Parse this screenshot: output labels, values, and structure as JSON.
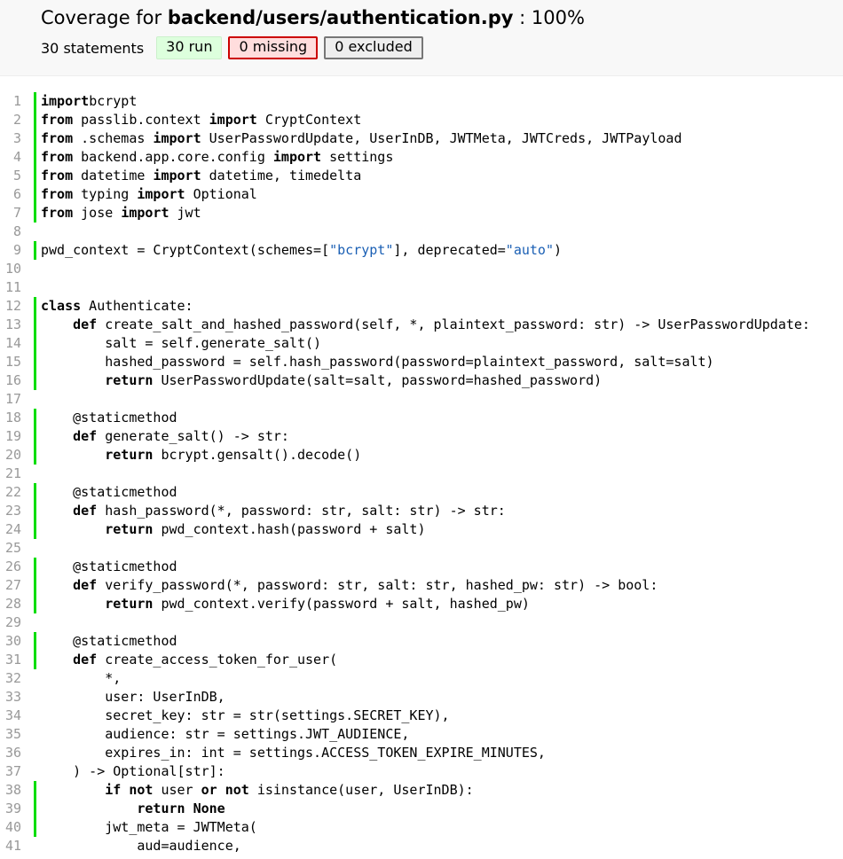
{
  "header": {
    "title_prefix": "Coverage for ",
    "file": "backend/users/authentication.py",
    "title_suffix": " : 100%",
    "statements": "30 statements",
    "run": "30 run",
    "missing": "0 missing",
    "excluded": "0 excluded"
  },
  "source": [
    {
      "n": "1",
      "run": true,
      "t": [
        [
          "k",
          "import"
        ],
        [
          "",
          "bcrypt"
        ]
      ]
    },
    {
      "n": "2",
      "run": true,
      "t": [
        [
          "k",
          "from"
        ],
        [
          "",
          " passlib.context "
        ],
        [
          "k",
          "import"
        ],
        [
          "",
          " CryptContext"
        ]
      ]
    },
    {
      "n": "3",
      "run": true,
      "t": [
        [
          "k",
          "from"
        ],
        [
          "",
          " .schemas "
        ],
        [
          "k",
          "import"
        ],
        [
          "",
          " UserPasswordUpdate, UserInDB, JWTMeta, JWTCreds, JWTPayload"
        ]
      ]
    },
    {
      "n": "4",
      "run": true,
      "t": [
        [
          "k",
          "from"
        ],
        [
          "",
          " backend.app.core.config "
        ],
        [
          "k",
          "import"
        ],
        [
          "",
          " settings"
        ]
      ]
    },
    {
      "n": "5",
      "run": true,
      "t": [
        [
          "k",
          "from"
        ],
        [
          "",
          " datetime "
        ],
        [
          "k",
          "import"
        ],
        [
          "",
          " datetime, timedelta"
        ]
      ]
    },
    {
      "n": "6",
      "run": true,
      "t": [
        [
          "k",
          "from"
        ],
        [
          "",
          " typing "
        ],
        [
          "k",
          "import"
        ],
        [
          "",
          " Optional"
        ]
      ]
    },
    {
      "n": "7",
      "run": true,
      "t": [
        [
          "k",
          "from"
        ],
        [
          "",
          " jose "
        ],
        [
          "k",
          "import"
        ],
        [
          "",
          " jwt"
        ]
      ]
    },
    {
      "n": "8",
      "run": false,
      "t": []
    },
    {
      "n": "9",
      "run": true,
      "t": [
        [
          "",
          "pwd_context = CryptContext(schemes=["
        ],
        [
          "s",
          "\"bcrypt\""
        ],
        [
          "",
          "], deprecated="
        ],
        [
          "s",
          "\"auto\""
        ],
        [
          "",
          ")"
        ]
      ]
    },
    {
      "n": "10",
      "run": false,
      "t": []
    },
    {
      "n": "11",
      "run": false,
      "t": []
    },
    {
      "n": "12",
      "run": true,
      "t": [
        [
          "k",
          "class"
        ],
        [
          "",
          " Authenticate:"
        ]
      ]
    },
    {
      "n": "13",
      "run": true,
      "t": [
        [
          "",
          "    "
        ],
        [
          "k",
          "def"
        ],
        [
          "",
          " create_salt_and_hashed_password(self, *, plaintext_password: str) -> UserPasswordUpdate:"
        ]
      ]
    },
    {
      "n": "14",
      "run": true,
      "t": [
        [
          "",
          "        salt = self.generate_salt()"
        ]
      ]
    },
    {
      "n": "15",
      "run": true,
      "t": [
        [
          "",
          "        hashed_password = self.hash_password(password=plaintext_password, salt=salt)"
        ]
      ]
    },
    {
      "n": "16",
      "run": true,
      "t": [
        [
          "",
          "        "
        ],
        [
          "k",
          "return"
        ],
        [
          "",
          " UserPasswordUpdate(salt=salt, password=hashed_password)"
        ]
      ]
    },
    {
      "n": "17",
      "run": false,
      "t": []
    },
    {
      "n": "18",
      "run": true,
      "t": [
        [
          "",
          "    @staticmethod"
        ]
      ]
    },
    {
      "n": "19",
      "run": true,
      "t": [
        [
          "",
          "    "
        ],
        [
          "k",
          "def"
        ],
        [
          "",
          " generate_salt() -> str:"
        ]
      ]
    },
    {
      "n": "20",
      "run": true,
      "t": [
        [
          "",
          "        "
        ],
        [
          "k",
          "return"
        ],
        [
          "",
          " bcrypt.gensalt().decode()"
        ]
      ]
    },
    {
      "n": "21",
      "run": false,
      "t": []
    },
    {
      "n": "22",
      "run": true,
      "t": [
        [
          "",
          "    @staticmethod"
        ]
      ]
    },
    {
      "n": "23",
      "run": true,
      "t": [
        [
          "",
          "    "
        ],
        [
          "k",
          "def"
        ],
        [
          "",
          " hash_password(*, password: str, salt: str) -> str:"
        ]
      ]
    },
    {
      "n": "24",
      "run": true,
      "t": [
        [
          "",
          "        "
        ],
        [
          "k",
          "return"
        ],
        [
          "",
          " pwd_context.hash(password + salt)"
        ]
      ]
    },
    {
      "n": "25",
      "run": false,
      "t": []
    },
    {
      "n": "26",
      "run": true,
      "t": [
        [
          "",
          "    @staticmethod"
        ]
      ]
    },
    {
      "n": "27",
      "run": true,
      "t": [
        [
          "",
          "    "
        ],
        [
          "k",
          "def"
        ],
        [
          "",
          " verify_password(*, password: str, salt: str, hashed_pw: str) -> bool:"
        ]
      ]
    },
    {
      "n": "28",
      "run": true,
      "t": [
        [
          "",
          "        "
        ],
        [
          "k",
          "return"
        ],
        [
          "",
          " pwd_context.verify(password + salt, hashed_pw)"
        ]
      ]
    },
    {
      "n": "29",
      "run": false,
      "t": []
    },
    {
      "n": "30",
      "run": true,
      "t": [
        [
          "",
          "    @staticmethod"
        ]
      ]
    },
    {
      "n": "31",
      "run": true,
      "t": [
        [
          "",
          "    "
        ],
        [
          "k",
          "def"
        ],
        [
          "",
          " create_access_token_for_user("
        ]
      ]
    },
    {
      "n": "32",
      "run": false,
      "t": [
        [
          "",
          "        *,"
        ]
      ]
    },
    {
      "n": "33",
      "run": false,
      "t": [
        [
          "",
          "        user: UserInDB,"
        ]
      ]
    },
    {
      "n": "34",
      "run": false,
      "t": [
        [
          "",
          "        secret_key: str = str(settings.SECRET_KEY),"
        ]
      ]
    },
    {
      "n": "35",
      "run": false,
      "t": [
        [
          "",
          "        audience: str = settings.JWT_AUDIENCE,"
        ]
      ]
    },
    {
      "n": "36",
      "run": false,
      "t": [
        [
          "",
          "        expires_in: int = settings.ACCESS_TOKEN_EXPIRE_MINUTES,"
        ]
      ]
    },
    {
      "n": "37",
      "run": false,
      "t": [
        [
          "",
          "    ) -> Optional[str]:"
        ]
      ]
    },
    {
      "n": "38",
      "run": true,
      "t": [
        [
          "",
          "        "
        ],
        [
          "k",
          "if not"
        ],
        [
          "",
          " user "
        ],
        [
          "k",
          "or not"
        ],
        [
          "",
          " isinstance(user, UserInDB):"
        ]
      ]
    },
    {
      "n": "39",
      "run": true,
      "t": [
        [
          "",
          "            "
        ],
        [
          "k",
          "return None"
        ]
      ]
    },
    {
      "n": "40",
      "run": true,
      "t": [
        [
          "",
          "        jwt_meta = JWTMeta("
        ]
      ]
    },
    {
      "n": "41",
      "run": false,
      "t": [
        [
          "",
          "            aud=audience,"
        ]
      ]
    }
  ]
}
